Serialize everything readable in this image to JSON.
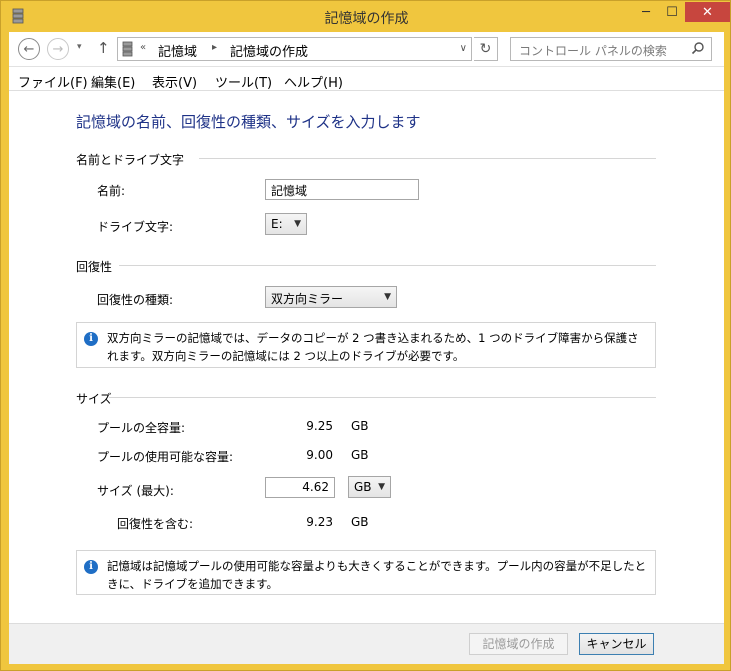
{
  "window": {
    "title": "記憶域の作成",
    "minimize_glyph": "─",
    "maximize_glyph": "☐",
    "close_glyph": "✕",
    "accent_color": "#f0c63e",
    "app_icon": "storage-drive-icon"
  },
  "navigation": {
    "back_glyph": "←",
    "forward_glyph": "→",
    "recent_glyph": "▾",
    "up_glyph": "↑",
    "overflow_glyph": "«",
    "breadcrumb": [
      "記憶域",
      "記憶域の作成"
    ],
    "breadcrumb_sep": "▸",
    "address_dropdown_glyph": "∨",
    "refresh_glyph": "↻",
    "search_placeholder": "コントロール パネルの検索"
  },
  "menu": [
    "ファイル(F)",
    "編集(E)",
    "表示(V)",
    "ツール(T)",
    "ヘルプ(H)"
  ],
  "page": {
    "heading": "記憶域の名前、回復性の種類、サイズを入力します",
    "name_section": {
      "title": "名前とドライブ文字",
      "name_label": "名前:",
      "name_value": "記憶域",
      "drive_label": "ドライブ文字:",
      "drive_value": "E:"
    },
    "resiliency_section": {
      "title": "回復性",
      "type_label": "回復性の種類:",
      "type_value": "双方向ミラー",
      "info": "双方向ミラーの記憶域では、データのコピーが 2 つ書き込まれるため、1 つのドライブ障害から保護されます。双方向ミラーの記憶域には 2 つ以上のドライブが必要です。"
    },
    "size_section": {
      "title": "サイズ",
      "total_label": "プールの全容量:",
      "total_value": "9.25",
      "total_unit": "GB",
      "available_label": "プールの使用可能な容量:",
      "available_value": "9.00",
      "available_unit": "GB",
      "max_label": "サイズ (最大):",
      "max_value": "4.62",
      "max_unit": "GB",
      "incl_label": "回復性を含む:",
      "incl_value": "9.23",
      "incl_unit": "GB",
      "info": "記憶域は記憶域プールの使用可能な容量よりも大きくすることができます。プール内の容量が不足したときに、ドライブを追加できます。"
    },
    "info_glyph": "i",
    "combo_glyph": "▼"
  },
  "footer": {
    "create_label": "記憶域の作成",
    "cancel_label": "キャンセル"
  }
}
